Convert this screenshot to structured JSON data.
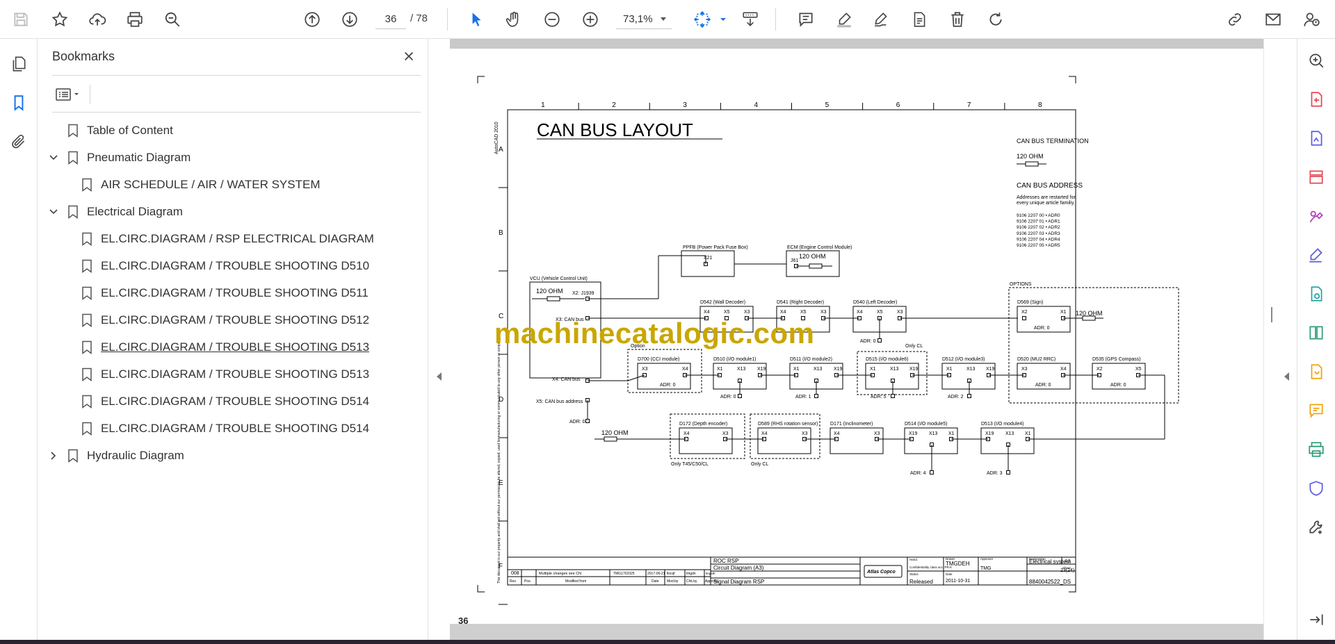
{
  "toolbar": {
    "current_page": "36",
    "total_pages": "/ 78",
    "zoom": "73,1%",
    "icons": [
      "save-icon",
      "star-icon",
      "cloud-upload-icon",
      "print-icon",
      "find-icon",
      "page-up-icon",
      "page-down-icon",
      "select-arrow-icon",
      "hand-icon",
      "zoom-out-icon",
      "zoom-in-icon",
      "fit-page-icon",
      "scroll-mode-icon",
      "comment-icon",
      "highlight-icon",
      "draw-icon",
      "stamp-icon",
      "delete-icon",
      "rotate-icon",
      "share-link-icon",
      "email-icon",
      "account-icon"
    ]
  },
  "bookmarks": {
    "title": "Bookmarks",
    "items": [
      {
        "label": "Table of Content",
        "level": 0,
        "chevron": "none"
      },
      {
        "label": "Pneumatic Diagram",
        "level": 0,
        "chevron": "down"
      },
      {
        "label": "AIR SCHEDULE / AIR / WATER SYSTEM",
        "level": 1,
        "chevron": "none"
      },
      {
        "label": "Electrical Diagram",
        "level": 0,
        "chevron": "down"
      },
      {
        "label": "EL.CIRC.DIAGRAM / RSP ELECTRICAL DIAGRAM",
        "level": 1,
        "chevron": "none"
      },
      {
        "label": "EL.CIRC.DIAGRAM / TROUBLE SHOOTING D510",
        "level": 1,
        "chevron": "none"
      },
      {
        "label": "EL.CIRC.DIAGRAM / TROUBLE SHOOTING D511",
        "level": 1,
        "chevron": "none"
      },
      {
        "label": "EL.CIRC.DIAGRAM / TROUBLE SHOOTING D512",
        "level": 1,
        "chevron": "none"
      },
      {
        "label": "EL.CIRC.DIAGRAM / TROUBLE SHOOTING D513",
        "level": 1,
        "chevron": "none",
        "underline": true
      },
      {
        "label": "EL.CIRC.DIAGRAM / TROUBLE SHOOTING D513",
        "level": 1,
        "chevron": "none"
      },
      {
        "label": "EL.CIRC.DIAGRAM / TROUBLE SHOOTING D514",
        "level": 1,
        "chevron": "none"
      },
      {
        "label": "EL.CIRC.DIAGRAM / TROUBLE SHOOTING D514",
        "level": 1,
        "chevron": "none"
      },
      {
        "label": "Hydraulic Diagram",
        "level": 0,
        "chevron": "right"
      }
    ]
  },
  "document": {
    "page_label": "36",
    "watermark": "machinecatalogic.com",
    "drawing": {
      "title": "CAN BUS LAYOUT",
      "side_label": "AutoCAD 2010",
      "col_numbers": [
        "1",
        "2",
        "3",
        "4",
        "5",
        "6",
        "7",
        "8"
      ],
      "row_letters": [
        "A",
        "B",
        "C",
        "D",
        "E",
        "F"
      ],
      "termination_title": "CAN BUS TERMINATION",
      "termination_value": "120 OHM",
      "address_title": "CAN BUS ADDRESS",
      "address_note_1": "Addresses are restarted for",
      "address_note_2": "every unique article familiy.",
      "address_list": [
        "9106 2207 00 • ADR0",
        "9106 2207 01 • ADR1",
        "9106 2207 02 • ADR2",
        "9106 2207 03 • ADR3",
        "9106 2207 04 • ADR4",
        "9106 2207 05 • ADR5"
      ],
      "ppfb": "PPFB (Power Pack Fuse Box)",
      "ppfb_conn": "X21",
      "ecm": "ECM (Engine Control Module)",
      "ecm_conn": "J61",
      "ohm": "120 OHM",
      "vcu": "VCU (Vehicle Control Unit)",
      "vcu_x2": "X2: J1939",
      "vcu_x3": "X3: CAN bus",
      "vcu_x4": "X4: CAN bus",
      "vcu_x5": "X5: CAN bus address",
      "adr0": "ADR: 0",
      "adr1": "ADR: 1",
      "adr2": "ADR: 2",
      "adr3": "ADR: 3",
      "adr4": "ADR: 4",
      "adr5": "ADR: 5",
      "d542": "D542 (Wall Decoder)",
      "d541": "D541 (Right Decoder)",
      "d540": "D540 (Left Decoder)",
      "options": "OPTIONS",
      "d569": "D569 (Sign)",
      "option": "Option",
      "only_cl": "Only CL",
      "d700": "D700 (CCI module)",
      "d510": "D510 (I/O module1)",
      "d511": "D511 (I/O module2)",
      "d515": "D515 (I/O module6)",
      "d512": "D512 (I/O module3)",
      "d520": "D520 (MU2 RRC)",
      "d535": "D535 (GPS Compass)",
      "d172": "D172 (Depth encoder)",
      "d589": "D589 (RHS rotation sensor)",
      "d171": "D171 (Inclinometer)",
      "d514": "D514 (I/O module5)",
      "d513": "D513 (I/O module4)",
      "only_t45": "Only T45/C50/CL",
      "only_cl2": "Only CL",
      "conn_x1": "X1",
      "conn_x2": "X2",
      "conn_x3": "X3",
      "conn_x4": "X4",
      "conn_x5": "X5",
      "conn_x13": "X13",
      "conn_x19": "X19",
      "disclaimer": "This document is our property and shall not without our permission be altered, copied, used for manufacturing or communicated to any other person or company.",
      "tb_rev_no": "008",
      "tb_change": "Multiple changes see CN",
      "tb_cn": "TMG1702325",
      "tb_date": "2017-06-21",
      "tb_modby": "llocqf",
      "tb_chk": "lmgdn",
      "tb_appd": "lmgeth",
      "tb_rev": "Rev.",
      "tb_pos": "Pos.",
      "tb_modified": "Modified from",
      "tb_date_h": "Date",
      "tb_modby_h": "Mod.by",
      "tb_chk_h": "Chk.by",
      "tb_appd_h": "Appd.by",
      "tb_name": "ROC RSP",
      "tb_type": "Circuit Diagram (A3)",
      "tb_desc": "Signal Diagram RSP",
      "tb_brand": "Atlas Copco",
      "tb_drawn": "TMGDEH",
      "tb_drawn_h": "Drawn",
      "tb_approver_h": "Approver",
      "tb_owner": "TMG",
      "tb_status": "Released",
      "tb_issue_date": "2011-10-31",
      "tb_system": "Electrical system",
      "tb_size": "A3",
      "tb_sheet": "23(24)",
      "tb_docno": "8840042522_DS",
      "tb_handle": "Hand.",
      "tb_conf": "Confidentiality class acc. PR-K",
      "tb_status_h": "Status",
      "tb_date_h2": "Date",
      "tb_designation": "Designation",
      "tb_sheet_h": "Sheet"
    }
  },
  "colors": {
    "accent": "#1473e6",
    "watermark": "#c9a600",
    "toolbar_icon": "#444444",
    "right_tools": [
      "#e34850",
      "#5c5ce0",
      "#e34850",
      "#b33bbd",
      "#5c5ce0",
      "#26a3a3",
      "#2d9d78",
      "#f0a30a",
      "#f0a30a",
      "#2d9d78",
      "#5c5ce0",
      "#444444"
    ]
  }
}
